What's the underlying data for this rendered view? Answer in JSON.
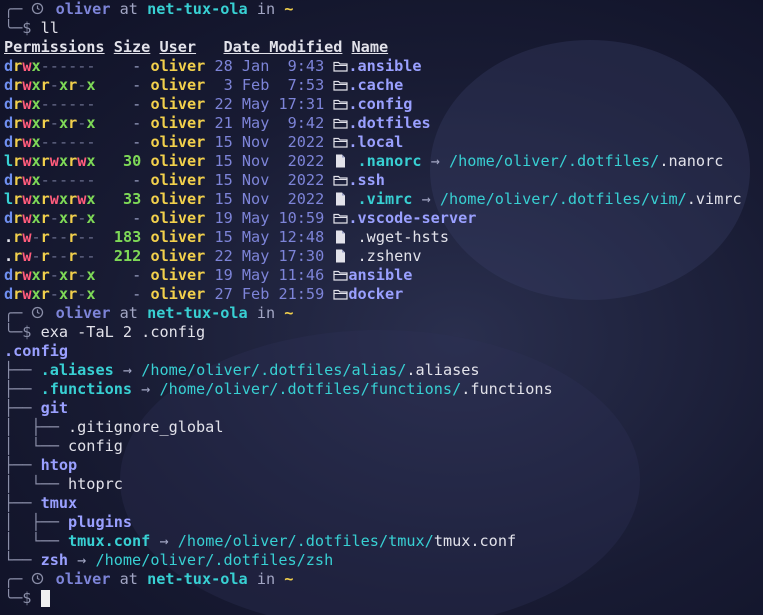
{
  "prompt": {
    "user": "oliver",
    "at": "at",
    "host": "net-tux-ola",
    "in": "in",
    "dir": "~"
  },
  "commands": {
    "cmd1": "ll",
    "cmd2": "exa -TaL 2 .config"
  },
  "listing": {
    "headers": {
      "permissions": "Permissions",
      "size": "Size",
      "user": "User",
      "date": "Date Modified",
      "name": "Name"
    },
    "rows": [
      {
        "perms": "drwx------",
        "size": "-",
        "owner": "oliver",
        "date": "28 Jan  9:43",
        "type": "dir",
        "name": ".ansible",
        "target_dir": "",
        "target_file": ""
      },
      {
        "perms": "drwxr-xr-x",
        "size": "-",
        "owner": "oliver",
        "date": " 3 Feb  7:53",
        "type": "dir",
        "name": ".cache",
        "target_dir": "",
        "target_file": ""
      },
      {
        "perms": "drwx------",
        "size": "-",
        "owner": "oliver",
        "date": "22 May 17:31",
        "type": "dir",
        "name": ".config",
        "target_dir": "",
        "target_file": ""
      },
      {
        "perms": "drwxr-xr-x",
        "size": "-",
        "owner": "oliver",
        "date": "21 May  9:42",
        "type": "dir",
        "name": ".dotfiles",
        "target_dir": "",
        "target_file": ""
      },
      {
        "perms": "drwx------",
        "size": "-",
        "owner": "oliver",
        "date": "15 Nov  2022",
        "type": "dir",
        "name": ".local",
        "target_dir": "",
        "target_file": ""
      },
      {
        "perms": "lrwxrwxrwx",
        "size": "30",
        "owner": "oliver",
        "date": "15 Nov  2022",
        "type": "link",
        "name": ".nanorc",
        "target_dir": "/home/oliver/.dotfiles/",
        "target_file": ".nanorc"
      },
      {
        "perms": "drwx------",
        "size": "-",
        "owner": "oliver",
        "date": "15 Nov  2022",
        "type": "dir",
        "name": ".ssh",
        "target_dir": "",
        "target_file": ""
      },
      {
        "perms": "lrwxrwxrwx",
        "size": "33",
        "owner": "oliver",
        "date": "15 Nov  2022",
        "type": "link",
        "name": ".vimrc",
        "target_dir": "/home/oliver/.dotfiles/vim/",
        "target_file": ".vimrc"
      },
      {
        "perms": "drwxr-xr-x",
        "size": "-",
        "owner": "oliver",
        "date": "19 May 10:59",
        "type": "dir",
        "name": ".vscode-server",
        "target_dir": "",
        "target_file": ""
      },
      {
        "perms": ".rw-r--r--",
        "size": "183",
        "owner": "oliver",
        "date": "15 May 12:48",
        "type": "file",
        "name": ".wget-hsts",
        "target_dir": "",
        "target_file": ""
      },
      {
        "perms": ".rw-r--r--",
        "size": "212",
        "owner": "oliver",
        "date": "22 May 17:30",
        "type": "file",
        "name": ".zshenv",
        "target_dir": "",
        "target_file": ""
      },
      {
        "perms": "drwxr-xr-x",
        "size": "-",
        "owner": "oliver",
        "date": "19 May 11:46",
        "type": "dir",
        "name": "ansible",
        "target_dir": "",
        "target_file": ""
      },
      {
        "perms": "drwxr-xr-x",
        "size": "-",
        "owner": "oliver",
        "date": "27 Feb 21:59",
        "type": "dir",
        "name": "docker",
        "target_dir": "",
        "target_file": ""
      }
    ]
  },
  "tree": {
    "root": ".config",
    "items": [
      {
        "prefix": "├── ",
        "kind": "link",
        "name": ".aliases",
        "target_dir": "/home/oliver/.dotfiles/alias/",
        "target_file": ".aliases"
      },
      {
        "prefix": "├── ",
        "kind": "link",
        "name": ".functions",
        "target_dir": "/home/oliver/.dotfiles/functions/",
        "target_file": ".functions"
      },
      {
        "prefix": "├── ",
        "kind": "dir",
        "name": "git",
        "target_dir": "",
        "target_file": ""
      },
      {
        "prefix": "│  ├── ",
        "kind": "file",
        "name": ".gitignore_global",
        "target_dir": "",
        "target_file": ""
      },
      {
        "prefix": "│  └── ",
        "kind": "file",
        "name": "config",
        "target_dir": "",
        "target_file": ""
      },
      {
        "prefix": "├── ",
        "kind": "dir",
        "name": "htop",
        "target_dir": "",
        "target_file": ""
      },
      {
        "prefix": "│  └── ",
        "kind": "file",
        "name": "htoprc",
        "target_dir": "",
        "target_file": ""
      },
      {
        "prefix": "├── ",
        "kind": "dir",
        "name": "tmux",
        "target_dir": "",
        "target_file": ""
      },
      {
        "prefix": "│  ├── ",
        "kind": "dir",
        "name": "plugins",
        "target_dir": "",
        "target_file": ""
      },
      {
        "prefix": "│  └── ",
        "kind": "link",
        "name": "tmux.conf",
        "target_dir": "/home/oliver/.dotfiles/tmux/",
        "target_file": "tmux.conf"
      },
      {
        "prefix": "└── ",
        "kind": "dirlink",
        "name": "zsh",
        "target_dir": "/home/oliver/.dotfiles/zsh",
        "target_file": ""
      }
    ]
  },
  "symbols": {
    "prompt_corner": "╭─",
    "prompt_end": "╰─$",
    "arrow": "→",
    "at_glyph": "@"
  },
  "icons": {
    "dir": "folder-icon",
    "file": "file-icon",
    "link": "file-icon",
    "prompt": "clock-icon"
  }
}
